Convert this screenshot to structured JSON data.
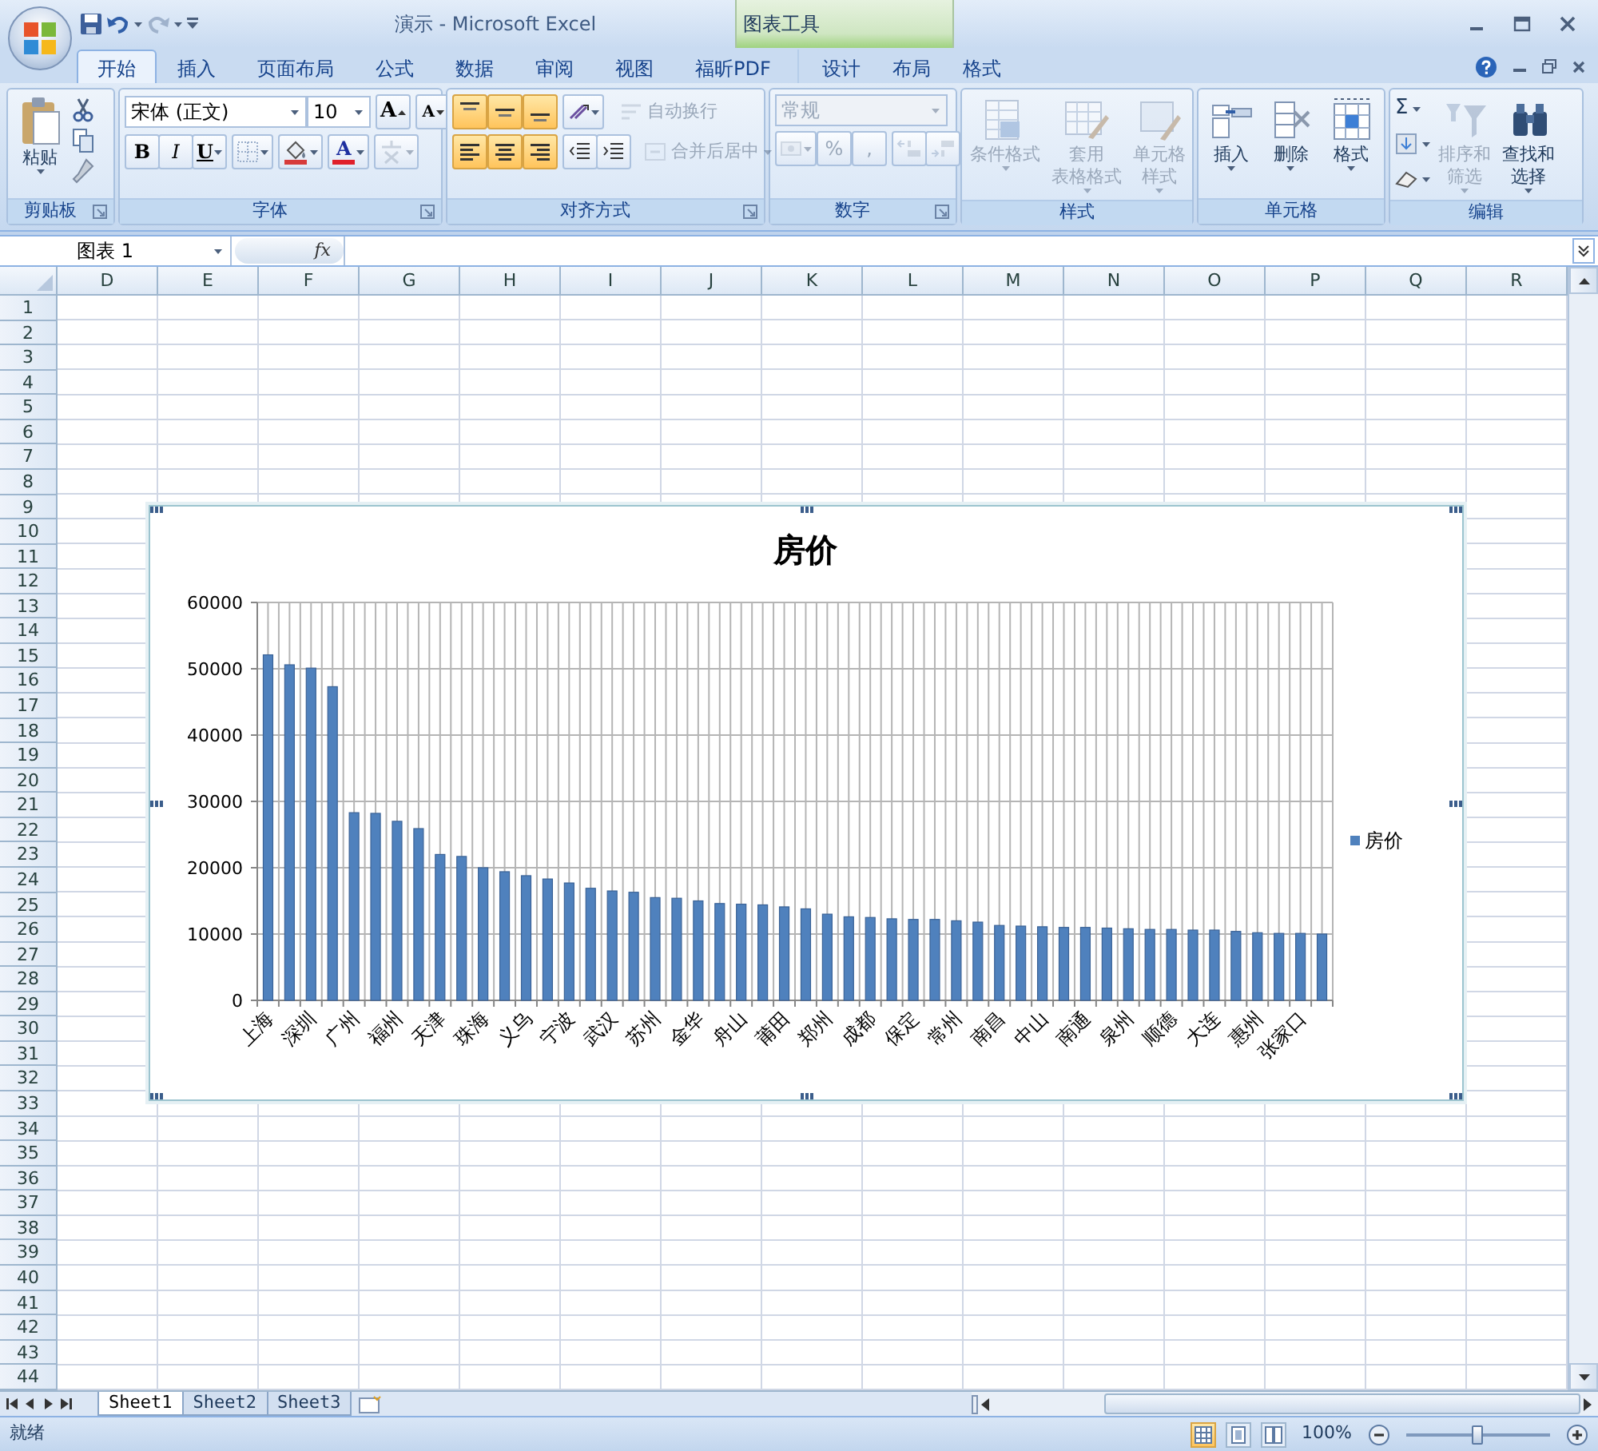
{
  "window": {
    "title": "演示 - Microsoft Excel",
    "contextual_group": "图表工具"
  },
  "tabs": [
    {
      "label": "开始",
      "selected": true,
      "contextual": false
    },
    {
      "label": "插入",
      "selected": false,
      "contextual": false
    },
    {
      "label": "页面布局",
      "selected": false,
      "contextual": false
    },
    {
      "label": "公式",
      "selected": false,
      "contextual": false
    },
    {
      "label": "数据",
      "selected": false,
      "contextual": false
    },
    {
      "label": "审阅",
      "selected": false,
      "contextual": false
    },
    {
      "label": "视图",
      "selected": false,
      "contextual": false
    },
    {
      "label": "福昕PDF",
      "selected": false,
      "contextual": false
    },
    {
      "label": "设计",
      "selected": false,
      "contextual": true
    },
    {
      "label": "布局",
      "selected": false,
      "contextual": true
    },
    {
      "label": "格式",
      "selected": false,
      "contextual": true
    }
  ],
  "ribbon": {
    "groups": [
      {
        "kind": "clipboard",
        "label": "剪贴板",
        "launcher": true,
        "paste": "粘贴"
      },
      {
        "kind": "font",
        "label": "字体",
        "launcher": true,
        "font_name": "宋体 (正文)",
        "font_size": "10",
        "grow": "A",
        "shrink": "A",
        "bold": "B",
        "italic": "I",
        "underline": "U",
        "font_color": "A"
      },
      {
        "kind": "alignment",
        "label": "对齐方式",
        "launcher": true,
        "vertical": [
          {
            "selected": true
          },
          {
            "selected": true
          },
          {
            "selected": true
          }
        ],
        "horizontal": [
          {
            "selected": true
          },
          {
            "selected": true
          },
          {
            "selected": true
          }
        ],
        "wrap": {
          "label": "自动换行",
          "disabled": true
        },
        "merge": {
          "label": "合并后居中",
          "disabled": true
        }
      },
      {
        "kind": "number",
        "label": "数字",
        "launcher": true,
        "disabled": true,
        "format": "常规",
        "percent": "%",
        "comma": ","
      },
      {
        "kind": "styles",
        "label": "样式",
        "launcher": false,
        "buttons": [
          {
            "lines": [
              "条件格式"
            ],
            "disabled": true
          },
          {
            "lines": [
              "套用",
              "表格格式"
            ],
            "disabled": true
          },
          {
            "lines": [
              "单元格",
              "样式"
            ],
            "disabled": true
          }
        ]
      },
      {
        "kind": "cells",
        "label": "单元格",
        "launcher": false,
        "buttons": [
          {
            "lines": [
              "插入"
            ],
            "disabled": false
          },
          {
            "lines": [
              "删除"
            ],
            "disabled": false
          },
          {
            "lines": [
              "格式"
            ],
            "disabled": false
          }
        ]
      },
      {
        "kind": "editing",
        "label": "编辑",
        "launcher": false,
        "sigma": "Σ",
        "buttons": [
          {
            "lines": [
              "排序和",
              "筛选"
            ],
            "disabled": true
          },
          {
            "lines": [
              "查找和",
              "选择"
            ],
            "disabled": false
          }
        ]
      }
    ]
  },
  "formula_bar": {
    "name_box": "图表 1",
    "fx": "fx"
  },
  "sheet": {
    "columns": [
      "D",
      "E",
      "F",
      "G",
      "H",
      "I",
      "J",
      "K",
      "L",
      "M",
      "N",
      "O",
      "P",
      "Q",
      "R"
    ],
    "rows": [
      "1",
      "2",
      "3",
      "4",
      "5",
      "6",
      "7",
      "8",
      "9",
      "10",
      "11",
      "12",
      "13",
      "14",
      "15",
      "16",
      "17",
      "18",
      "19",
      "20",
      "21",
      "22",
      "23",
      "24",
      "25",
      "26",
      "27",
      "28",
      "29",
      "30",
      "31",
      "32",
      "33",
      "34",
      "35",
      "36",
      "37",
      "38",
      "39",
      "40",
      "41",
      "42",
      "43",
      "44"
    ]
  },
  "chart": {
    "chart_data": {
      "type": "bar",
      "title": "房价",
      "categories": [
        "上海",
        null,
        "深圳",
        null,
        "广州",
        null,
        "福州",
        null,
        "天津",
        null,
        "珠海",
        null,
        "义乌",
        null,
        "宁波",
        null,
        "武汉",
        null,
        "苏州",
        null,
        "金华",
        null,
        "舟山",
        null,
        "莆田",
        null,
        "郑州",
        null,
        "成都",
        null,
        "保定",
        null,
        "常州",
        null,
        "南昌",
        null,
        "中山",
        null,
        "南通",
        null,
        "泉州",
        null,
        "顺德",
        null,
        "大连",
        null,
        "惠州",
        null,
        "张家口",
        null
      ],
      "series": [
        {
          "name": "房价",
          "color": "#4f81bd",
          "values": [
            52100,
            50600,
            50100,
            47300,
            28300,
            28200,
            27000,
            25900,
            22000,
            21700,
            20000,
            19400,
            18800,
            18300,
            17700,
            16900,
            16500,
            16300,
            15500,
            15400,
            15000,
            14600,
            14500,
            14400,
            14100,
            13800,
            13000,
            12600,
            12500,
            12300,
            12200,
            12200,
            12000,
            11800,
            11300,
            11200,
            11100,
            11000,
            11000,
            10900,
            10800,
            10700,
            10700,
            10600,
            10600,
            10400,
            10200,
            10100,
            10100,
            10000
          ]
        }
      ],
      "grid": true,
      "ylim": [
        0,
        60000
      ],
      "yticks": [
        0,
        10000,
        20000,
        30000,
        40000,
        50000,
        60000
      ]
    }
  },
  "sheet_tabs": [
    {
      "label": "Sheet1",
      "selected": true
    },
    {
      "label": "Sheet2",
      "selected": false
    },
    {
      "label": "Sheet3",
      "selected": false
    }
  ],
  "status_bar": {
    "status": "就绪",
    "view_buttons": [
      {
        "selected": true
      },
      {
        "selected": false
      },
      {
        "selected": false
      }
    ],
    "zoom": "100%",
    "zoom_slider": {
      "level": 0.5
    }
  }
}
